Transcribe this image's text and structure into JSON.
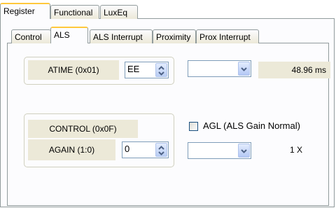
{
  "main_tabs": [
    "Register",
    "Functional",
    "LuxEq"
  ],
  "sub_tabs": [
    "Control",
    "ALS",
    "ALS Interrupt",
    "Proximity",
    "Prox Interrupt"
  ],
  "atime": {
    "label": "ATIME (0x01)",
    "value": "EE",
    "combo_value": "",
    "readout": "48.96 ms"
  },
  "control": {
    "label": "CONTROL (0x0F)",
    "again_label": "AGAIN (1:0)",
    "again_value": "0",
    "combo_value": "",
    "gain_readout": "1 X",
    "agl_label": "AGL (ALS Gain Normal)",
    "agl_checked": false
  },
  "icons": {
    "spin": "spin-arrows-icon",
    "dropdown": "chevron-down-icon"
  },
  "colors": {
    "active_tab_accent": "#ffc83c",
    "label_bg": "#ece9d8",
    "control_border": "#7f9db9"
  }
}
